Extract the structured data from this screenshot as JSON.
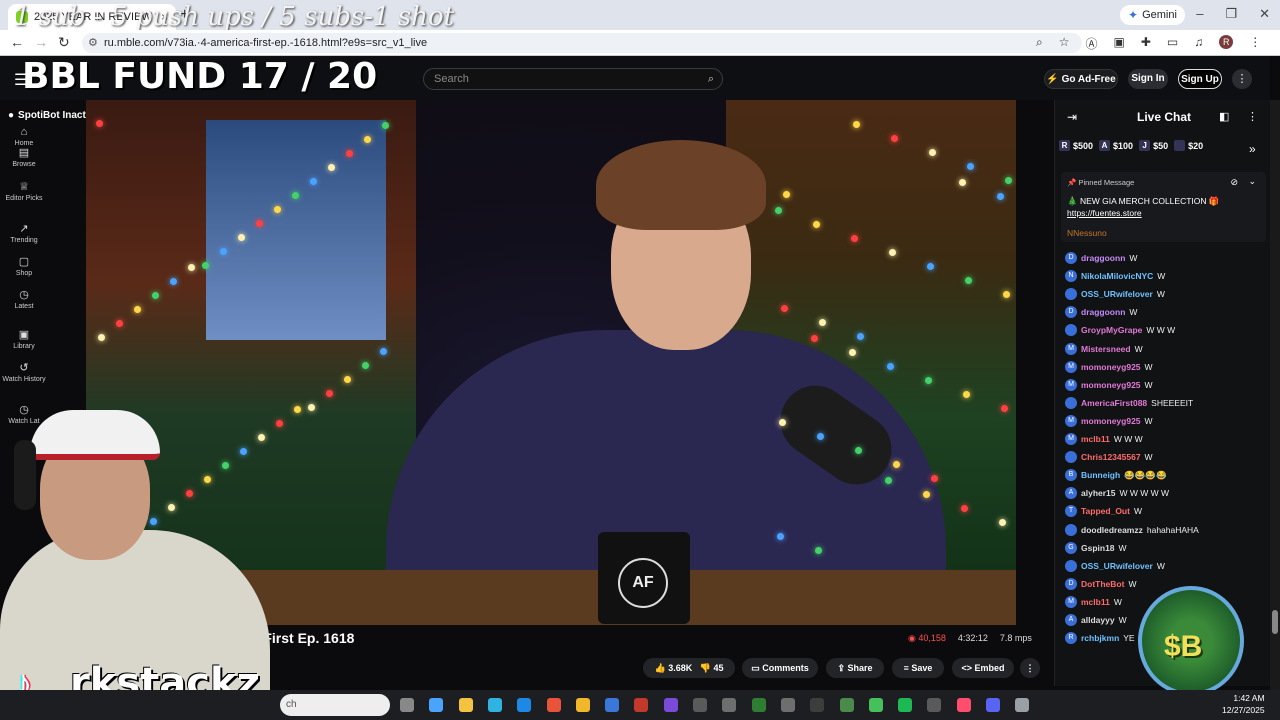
{
  "browser": {
    "tab_title": "2025 YEAR IN REVIEW | A",
    "url": "rumble.com/v73ia…-america-first-ep.-1618.html?e9s=src_v1_live",
    "url_shown": "ru.mble.com/v73ia.·4-america-first-ep.-1618.html?e9s=src_v1_live",
    "gemini_label": "Gemini",
    "avatar_letter": "R"
  },
  "overlay": {
    "stream_text": "1 sub - 5 push ups / 5 subs-1 shot",
    "fund_text": "BBL FUND  17 / 20",
    "streamer_name": "rkstackz",
    "coin_label": "$B"
  },
  "header": {
    "search_placeholder": "Search",
    "go_adfree": "Go Ad-Free",
    "sign_in": "Sign In",
    "sign_up": "Sign Up"
  },
  "leftnav": {
    "spotibot": "SpotiBot Inactive",
    "items": [
      {
        "label": "Home"
      },
      {
        "label": "Browse"
      },
      {
        "label": "Editor Picks"
      },
      {
        "label": "Trending"
      },
      {
        "label": "Shop"
      },
      {
        "label": "Latest"
      },
      {
        "label": "Library"
      },
      {
        "label": "Watch History"
      },
      {
        "label": "Watch Lat"
      }
    ]
  },
  "video": {
    "title": "ica First Ep. 1618",
    "views": "40,158",
    "duration": "4:32:12",
    "bitrate": "7.8 mps",
    "likes": "3.68K",
    "dislikes": "45",
    "comments_label": "Comments",
    "share_label": "Share",
    "save_label": "Save",
    "embed_label": "Embed",
    "mug_text": "AF"
  },
  "chat": {
    "title": "Live Chat",
    "rants": [
      {
        "badge": "R",
        "amount": "$500"
      },
      {
        "badge": "A",
        "amount": "$100"
      },
      {
        "badge": "J",
        "amount": "$50"
      },
      {
        "badge": "",
        "amount": "$20"
      }
    ],
    "pinned": {
      "header": "Pinned Message",
      "message": "🎄 NEW GIA MERCH COLLECTION 🎁",
      "link": "https://fuentes.store",
      "author": "NNessuno"
    },
    "messages": [
      {
        "initial": "D",
        "user": "draggoonn",
        "text": "W",
        "color": "#c58af9"
      },
      {
        "initial": "N",
        "user": "NikolaMilovicNYC",
        "text": "W",
        "color": "#6ec1ff"
      },
      {
        "initial": "",
        "user": "OSS_URwifelover",
        "text": "W",
        "color": "#6ec1ff"
      },
      {
        "initial": "D",
        "user": "draggoonn",
        "text": "W",
        "color": "#c58af9"
      },
      {
        "initial": "",
        "user": "GroypMyGrape",
        "text": "W W W",
        "color": "#e07ad6"
      },
      {
        "initial": "M",
        "user": "Mistersneed",
        "text": "W",
        "color": "#e07ad6"
      },
      {
        "initial": "M",
        "user": "momoneyg925",
        "text": "W",
        "color": "#e07ad6"
      },
      {
        "initial": "M",
        "user": "momoneyg925",
        "text": "W",
        "color": "#e07ad6"
      },
      {
        "initial": "",
        "user": "AmericaFirst088",
        "text": "SHEEEEIT",
        "color": "#e07ad6"
      },
      {
        "initial": "M",
        "user": "momoneyg925",
        "text": "W",
        "color": "#e07ad6"
      },
      {
        "initial": "M",
        "user": "mclb11",
        "text": "W W W",
        "color": "#ff6b6b"
      },
      {
        "initial": "",
        "user": "Chris12345567",
        "text": "W",
        "color": "#ff6b6b"
      },
      {
        "initial": "B",
        "user": "Bunneigh",
        "text": "😂😂😂😂",
        "color": "#6ec1ff"
      },
      {
        "initial": "A",
        "user": "alyher15",
        "text": "W W W W W",
        "color": "#ddd"
      },
      {
        "initial": "T",
        "user": "Tapped_Out",
        "text": "W",
        "color": "#ff6b6b"
      },
      {
        "initial": "",
        "user": "doodledreamzz",
        "text": "hahahaHAHA",
        "color": "#ddd"
      },
      {
        "initial": "G",
        "user": "Gspin18",
        "text": "W",
        "color": "#ddd"
      },
      {
        "initial": "",
        "user": "OSS_URwifelover",
        "text": "W",
        "color": "#6ec1ff"
      },
      {
        "initial": "D",
        "user": "DotTheBot",
        "text": "W",
        "color": "#ff6b6b"
      },
      {
        "initial": "M",
        "user": "mclb11",
        "text": "W",
        "color": "#ff6b6b"
      },
      {
        "initial": "A",
        "user": "alldayyy",
        "text": "W",
        "color": "#ddd"
      },
      {
        "initial": "R",
        "user": "rchbjkmn",
        "text": "YE",
        "color": "#6ec1ff"
      }
    ]
  },
  "taskbar": {
    "search_label": "ch",
    "time": "1:42 AM",
    "date": "12/27/2025"
  }
}
